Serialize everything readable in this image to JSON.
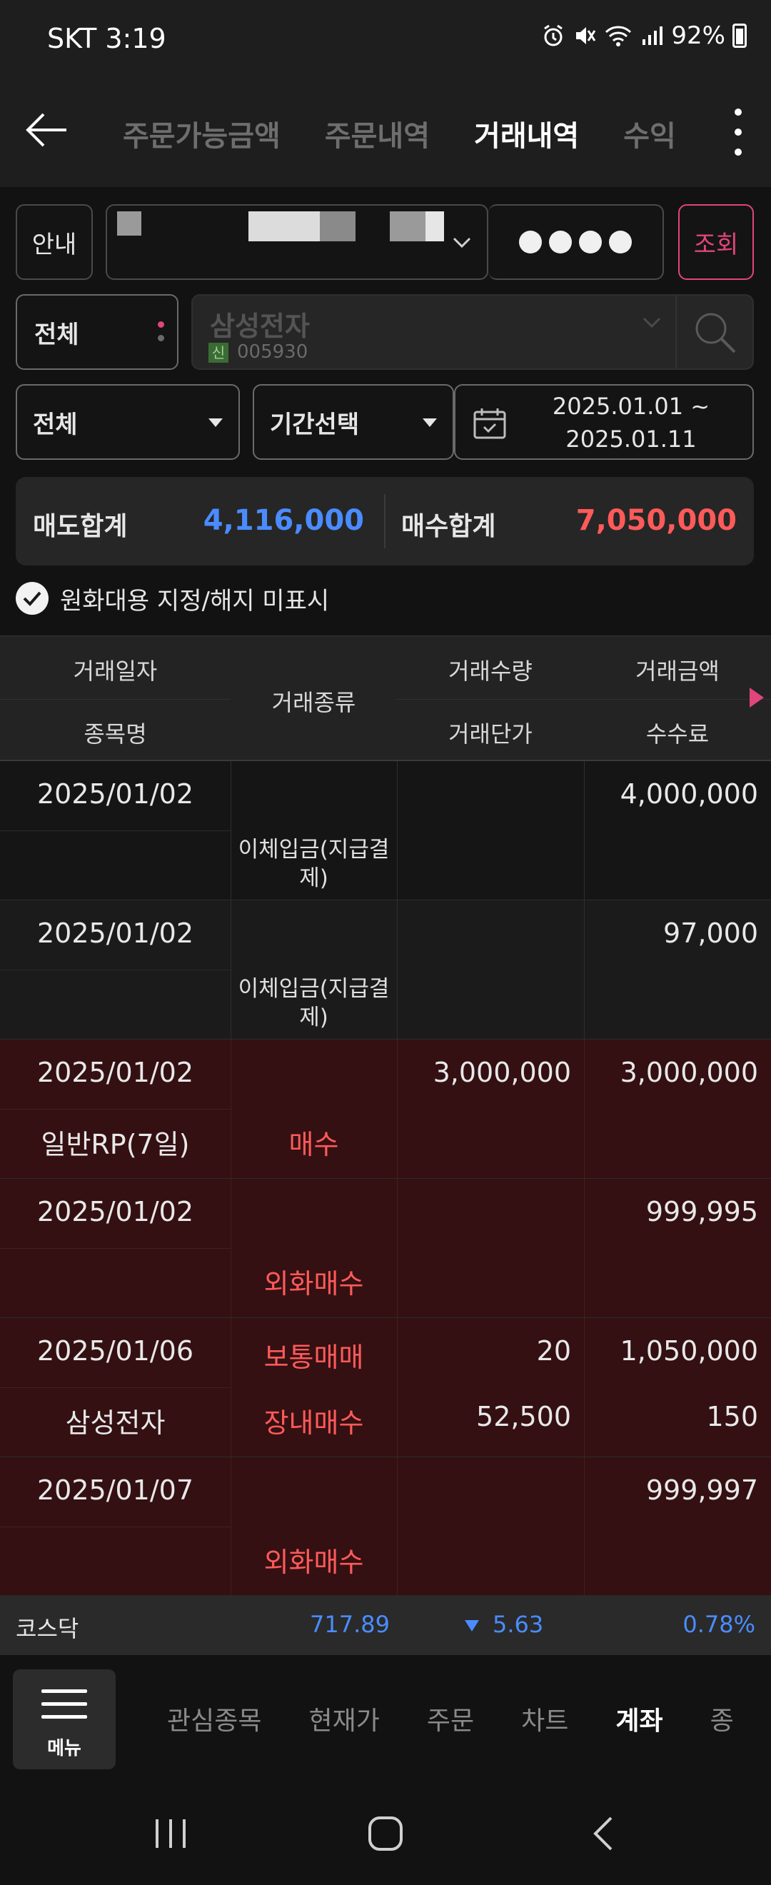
{
  "status_bar": {
    "carrier_time": "SKT 3:19",
    "battery": "92%"
  },
  "header": {
    "tabs": [
      {
        "label": "주문가능금액",
        "active": false
      },
      {
        "label": "주문내역",
        "active": false
      },
      {
        "label": "거래내역",
        "active": true
      },
      {
        "label": "수익",
        "active": false
      }
    ]
  },
  "controls": {
    "guide_label": "안내",
    "search_label": "조회",
    "category_label": "전체",
    "stock": {
      "name": "삼성전자",
      "badge": "신",
      "code": "005930"
    },
    "type_label": "전체",
    "period_label": "기간선택",
    "date_start": "2025.01.01 ~",
    "date_end": "2025.01.11"
  },
  "summary": {
    "sell_label": "매도합계",
    "sell_value": "4,116,000",
    "buy_label": "매수합계",
    "buy_value": "7,050,000"
  },
  "check_label": "원화대용 지정/해지 미표시",
  "table": {
    "headers": {
      "date": "거래일자",
      "name": "종목명",
      "kind": "거래종류",
      "qty": "거래수량",
      "price": "거래단가",
      "amount": "거래금액",
      "fee": "수수료"
    },
    "rows": [
      {
        "date": "2025/01/02",
        "name": "",
        "kind_top": "",
        "kind_bottom": "이체입금(지급결제)",
        "qty": "",
        "price": "",
        "amount": "4,000,000",
        "fee": ""
      },
      {
        "date": "2025/01/02",
        "name": "",
        "kind_top": "",
        "kind_bottom": "이체입금(지급결제)",
        "qty": "",
        "price": "",
        "amount": "97,000",
        "fee": ""
      },
      {
        "date": "2025/01/02",
        "name": "일반RP(7일)",
        "kind_top": "",
        "kind_bottom": "매수",
        "qty": "3,000,000",
        "price": "",
        "amount": "3,000,000",
        "fee": ""
      },
      {
        "date": "2025/01/02",
        "name": "",
        "kind_top": "",
        "kind_bottom": "외화매수",
        "qty": "",
        "price": "",
        "amount": "999,995",
        "fee": ""
      },
      {
        "date": "2025/01/06",
        "name": "삼성전자",
        "kind_top": "보통매매",
        "kind_bottom": "장내매수",
        "qty": "20",
        "price": "52,500",
        "amount": "1,050,000",
        "fee": "150"
      },
      {
        "date": "2025/01/07",
        "name": "",
        "kind_top": "",
        "kind_bottom": "외화매수",
        "qty": "",
        "price": "",
        "amount": "999,997",
        "fee": ""
      }
    ]
  },
  "ticker": {
    "name": "코스닥",
    "value": "717.89",
    "change": "5.63",
    "rate": "0.78%"
  },
  "bottom_nav": {
    "menu_label": "메뉴",
    "items": [
      {
        "label": "관심종목",
        "active": false
      },
      {
        "label": "현재가",
        "active": false
      },
      {
        "label": "주문",
        "active": false
      },
      {
        "label": "차트",
        "active": false
      },
      {
        "label": "계좌",
        "active": true
      },
      {
        "label": "종",
        "active": false
      }
    ]
  },
  "colors": {
    "accent_pink": "#e0457b",
    "sell_blue": "#4a8cff",
    "buy_red": "#ff5a5a",
    "buy_row_bg": "#341012"
  }
}
